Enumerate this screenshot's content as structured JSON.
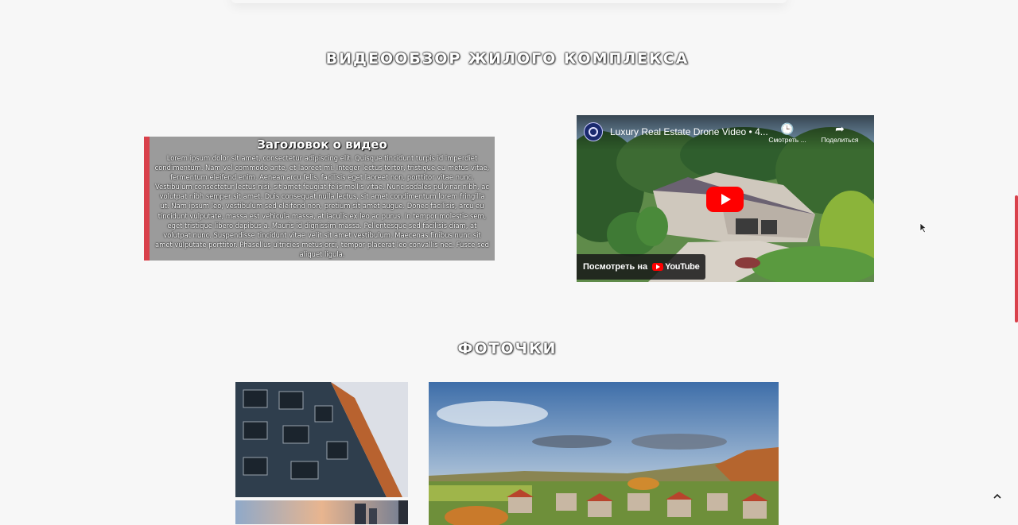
{
  "sections": {
    "video_title": "ВИДЕООБЗОР ЖИЛОГО КОМПЛЕКСА",
    "photos_title": "ФОТОЧКИ"
  },
  "text_card": {
    "heading": "Заголовок о видео",
    "body": "Lorem ipsum dolor sit amet, consectetur adipiscing elit. Quisque tincidunt turpis id imperdiet condimentum. Nam vel commodo ante, et laoreet mi. Integer lectus tortor, tristique eu metus vitae, fermentum eleifend enim. Aenean arcu felis, facilisis eget laoreet non, porttitor vitae nunc. Vestibulum consectetur lectus nisi, sit amet feugiat felis mollis vitae. Nunc sodales pulvinar nibh, ac volutpat nibh semper sit amet. Duis consequat nulla lectus, sit amet condimentum lorem fringilla ut. Nam ipsum leo, vestibulum sed eleifend non, pretium sit amet augue. Donec facilisis, arcu eu tincidunt vulputate, massa est vehicula massa, at iaculis ex leo ac purus. In tempor molestie sem, eget tristique libero dapibus a. Mauris id dignissim massa. Pellentesque sed facilisis diam, at volutpat nunc. Suspendisse tincidunt vitae velit sit amet vestibulum. Maecenas finibus nunc sit amet vulputate porttitor. Phasellus ultricies metus orci, tempor placerat leo convallis nec. Fusce sed aliquet ligula."
  },
  "video": {
    "title": "Luxury Real Estate Drone Video • 4...",
    "watch_later_label": "Смотреть ...",
    "share_label": "Поделиться",
    "watch_on_label": "Посмотреть на",
    "youtube_label": "YouTube"
  },
  "colors": {
    "accent": "#d9414b",
    "card_bg": "#9b9b9b",
    "page_bg": "#f7f7f7",
    "youtube_red": "#ff0000"
  },
  "icons": {
    "watch_later": "clock-icon",
    "share": "share-arrow-icon",
    "play": "play-icon",
    "back_to_top": "chevron-up-icon"
  }
}
